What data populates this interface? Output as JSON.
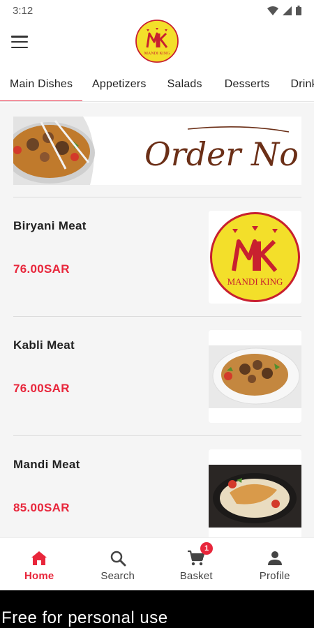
{
  "status": {
    "time": "3:12",
    "icons": [
      "wifi-icon",
      "signal-icon",
      "battery-icon"
    ]
  },
  "header": {
    "menu_icon": "hamburger-menu-icon",
    "logo": {
      "letters": "MK",
      "name": "MANDI KING"
    }
  },
  "tabs": [
    {
      "label": "Main Dishes",
      "active": true
    },
    {
      "label": "Appetizers"
    },
    {
      "label": "Salads"
    },
    {
      "label": "Desserts"
    },
    {
      "label": "Drink"
    }
  ],
  "banner": {
    "text": "Order Now"
  },
  "items": [
    {
      "name": "Biryani Meat",
      "price": "76.00SAR",
      "image": "mandi-king-logo"
    },
    {
      "name": "Kabli Meat",
      "price": "76.00SAR",
      "image": "rice-meat-plate"
    },
    {
      "name": "Mandi Meat",
      "price": "85.00SAR",
      "image": "mandi-meat-dish"
    }
  ],
  "bottom_nav": [
    {
      "label": "Home",
      "icon": "home-icon",
      "active": true
    },
    {
      "label": "Search",
      "icon": "search-icon"
    },
    {
      "label": "Basket",
      "icon": "cart-icon",
      "badge": "1"
    },
    {
      "label": "Profile",
      "icon": "person-icon"
    }
  ],
  "footer": {
    "text": "Free for personal use"
  },
  "colors": {
    "accent": "#e8263b",
    "logo_yellow": "#f3df2a",
    "logo_red": "#c8202f",
    "banner_script": "#6b2f17"
  }
}
